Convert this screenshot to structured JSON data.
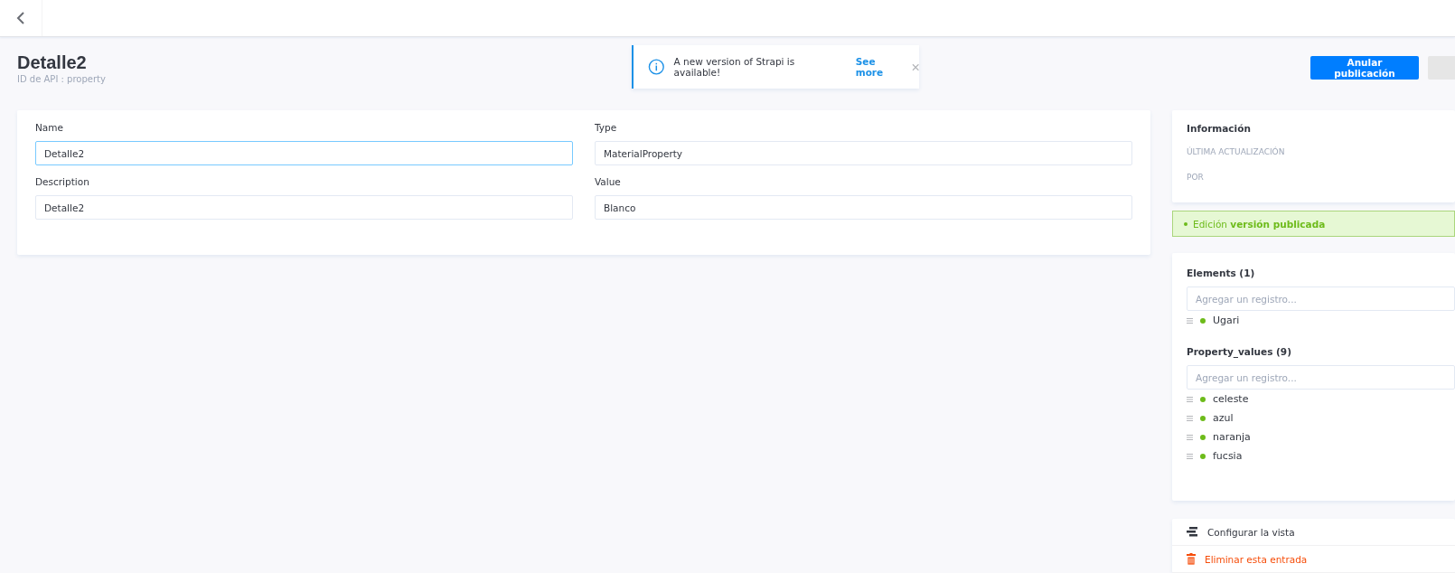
{
  "header": {
    "title": "Detalle2",
    "subtitle": "ID de API : property"
  },
  "notification": {
    "message": "A new version of Strapi is available!",
    "link": "See more"
  },
  "actions": {
    "primary": "Anular publicación"
  },
  "fields": [
    {
      "label": "Name",
      "value": "Detalle2",
      "focused": true
    },
    {
      "label": "Type",
      "value": "MaterialProperty",
      "focused": false
    },
    {
      "label": "Description",
      "value": "Detalle2",
      "focused": false
    },
    {
      "label": "Value",
      "value": "Blanco",
      "focused": false
    }
  ],
  "info": {
    "title": "Información",
    "rows": [
      "ÚLTIMA ACTUALIZACIÓN",
      "POR"
    ]
  },
  "status": "Edición **versión publicada**",
  "relations": [
    {
      "title": "Elements (1)",
      "placeholder": "Agregar un registro...",
      "items": [
        "Ugari"
      ]
    },
    {
      "title": "Property_values (9)",
      "placeholder": "Agregar un registro...",
      "items": [
        "celeste",
        "azul",
        "naranja",
        "fucsia"
      ]
    }
  ],
  "links": [
    {
      "kind": "configure",
      "label": "Configurar la vista"
    },
    {
      "kind": "delete",
      "label": "Eliminar esta entrada"
    }
  ]
}
